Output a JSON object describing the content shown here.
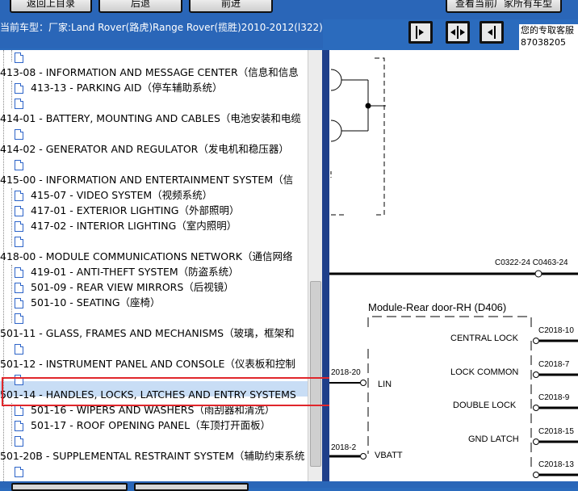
{
  "toolbar": {
    "btn1": "返回上目录",
    "btn2": "后退",
    "btn3": "前进",
    "btn4": "查看当前厂家所有车型"
  },
  "vehicle": "当前车型：厂家:Land Rover(路虎)Range Rover(揽胜)2010-2012(l322)",
  "hotline": {
    "line1": "您的专取客服",
    "line2": "87038205"
  },
  "tree": {
    "items": [
      {
        "label": "413-08 - INFORMATION AND MESSAGE CENTER（信息和信息"
      },
      {
        "label": "413-13 - PARKING AID（停车辅助系统）"
      },
      {
        "label": "414-01 - BATTERY, MOUNTING AND CABLES（电池安装和电缆"
      },
      {
        "label": "414-02 - GENERATOR AND REGULATOR（发电机和稳压器）"
      },
      {
        "label": "415-00 - INFORMATION AND ENTERTAINMENT SYSTEM（信"
      },
      {
        "label": "415-07 - VIDEO SYSTEM（视频系统）"
      },
      {
        "label": "417-01 - EXTERIOR LIGHTING（外部照明）"
      },
      {
        "label": "417-02 - INTERIOR LIGHTING（室内照明）"
      },
      {
        "label": "418-00 - MODULE COMMUNICATIONS NETWORK（通信网络"
      },
      {
        "label": "419-01 - ANTI-THEFT SYSTEM（防盗系统）"
      },
      {
        "label": "501-09 - REAR VIEW MIRRORS（后视镜）"
      },
      {
        "label": "501-10 - SEATING（座椅）"
      },
      {
        "label": "501-11 - GLASS, FRAMES AND MECHANISMS（玻璃，框架和"
      },
      {
        "label": "501-12 - INSTRUMENT PANEL AND CONSOLE（仪表板和控制"
      },
      {
        "label": "501-14 - HANDLES, LOCKS, LATCHES AND ENTRY SYSTEMS"
      },
      {
        "label": "501-16 - WIPERS AND WASHERS（雨刮器和清洗）"
      },
      {
        "label": "501-17 - ROOF OPENING PANEL（车顶打开面板）"
      },
      {
        "label": "501-20B - SUPPLEMENTAL RESTRAINT SYSTEM（辅助约束系统"
      }
    ]
  },
  "diagram": {
    "connector_top": "C0322-24 C0463-24",
    "module_title": "Module-Rear door-RH (D406)",
    "left_pin_lin": "2018-20",
    "lin": "LIN",
    "left_pin_vbatt": "2018-2",
    "vbatt": "VBATT",
    "central_lock": "CENTRAL LOCK",
    "lock_common": "LOCK COMMON",
    "double_lock": "DOUBLE LOCK",
    "gnd_latch": "GND LATCH",
    "pin_c10": "C2018-10",
    "pin_c7": "C2018-7",
    "pin_c9": "C2018-9",
    "pin_c15": "C2018-15",
    "pin_c13": "C2018-13"
  }
}
